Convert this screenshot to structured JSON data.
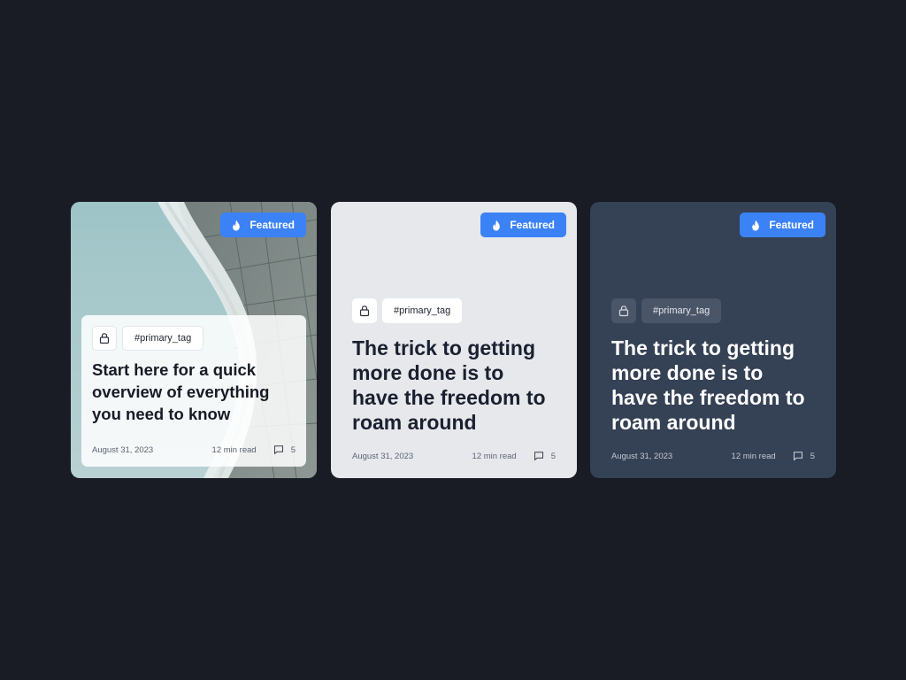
{
  "colors": {
    "page_background": "#191c24",
    "accent": "#3b82f6",
    "card_light": "#e6e8ec",
    "card_dark": "#354155"
  },
  "icons": {
    "featured": "flame-icon",
    "lock": "lock-icon",
    "comments": "comment-icon"
  },
  "cards": [
    {
      "badge": "Featured",
      "tag": "#primary_tag",
      "title": "Start here for a quick overview of everything you need to know",
      "date": "August 31, 2023",
      "read_time": "12 min read",
      "comments": "5"
    },
    {
      "badge": "Featured",
      "tag": "#primary_tag",
      "title": "The trick to getting more done is to have the freedom to roam around",
      "date": "August 31, 2023",
      "read_time": "12 min read",
      "comments": "5"
    },
    {
      "badge": "Featured",
      "tag": "#primary_tag",
      "title": "The trick to getting more done is to have the freedom to roam around",
      "date": "August 31, 2023",
      "read_time": "12 min read",
      "comments": "5"
    }
  ]
}
